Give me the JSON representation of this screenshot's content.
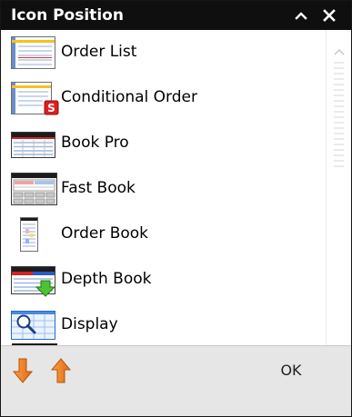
{
  "window": {
    "title": "Icon Position",
    "collapse_glyph": "^",
    "close_glyph": "✕"
  },
  "list": {
    "items": [
      {
        "label": "Order List",
        "icon": "order-list-icon"
      },
      {
        "label": "Conditional Order",
        "icon": "conditional-order-icon",
        "badge": "S"
      },
      {
        "label": "Book Pro",
        "icon": "book-pro-icon"
      },
      {
        "label": "Fast Book",
        "icon": "fast-book-icon"
      },
      {
        "label": "Order Book",
        "icon": "order-book-icon"
      },
      {
        "label": "Depth Book",
        "icon": "depth-book-icon"
      },
      {
        "label": "Display",
        "icon": "display-icon"
      }
    ]
  },
  "footer": {
    "ok_label": "OK",
    "move_down_icon": "arrow-down-icon",
    "move_up_icon": "arrow-up-icon"
  },
  "colors": {
    "titlebar": "#0f0f0f",
    "footer": "#e6e6e6",
    "arrow_orange": "#f0821e",
    "badge_red": "#e01e1e"
  }
}
